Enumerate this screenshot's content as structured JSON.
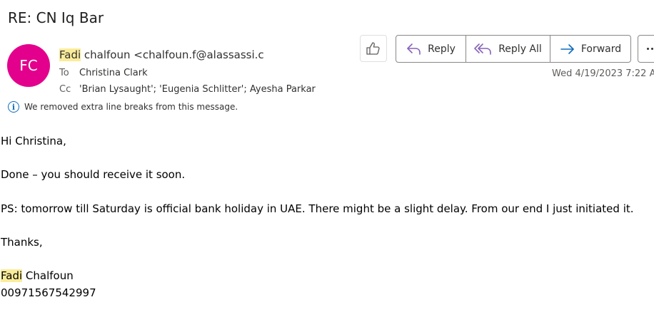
{
  "email": {
    "subject": "RE: CN Iq Bar",
    "avatar_initials": "FC",
    "avatar_color": "#e3008c",
    "sender_first_name": "Fadi",
    "sender_rest": " chalfoun <chalfoun.f@alassassi.c",
    "to_label": "To",
    "to_value": "Christina Clark",
    "cc_label": "Cc",
    "cc_value": "'Brian Lysaught'; 'Eugenia Schlitter'; Ayesha Parkar",
    "info_notice": "We removed extra line breaks from this message.",
    "date": "Wed 4/19/2023 7:22 A"
  },
  "actions": {
    "like_icon": "thumbs-up-icon",
    "reply_label": "Reply",
    "reply_all_label": "Reply All",
    "forward_label": "Forward",
    "accent_color": "#0f6cbd",
    "reply_color": "#8764b8"
  },
  "body": {
    "greeting": "Hi Christina,",
    "line1": "Done – you should receive it soon.",
    "line2": "PS: tomorrow till Saturday is official bank holiday in UAE. There might be a slight delay. From our end I just initiated it.",
    "thanks": "Thanks,",
    "sig_first_name": "Fadi",
    "sig_last_name": " Chalfoun",
    "sig_phone": "00971567542997"
  }
}
